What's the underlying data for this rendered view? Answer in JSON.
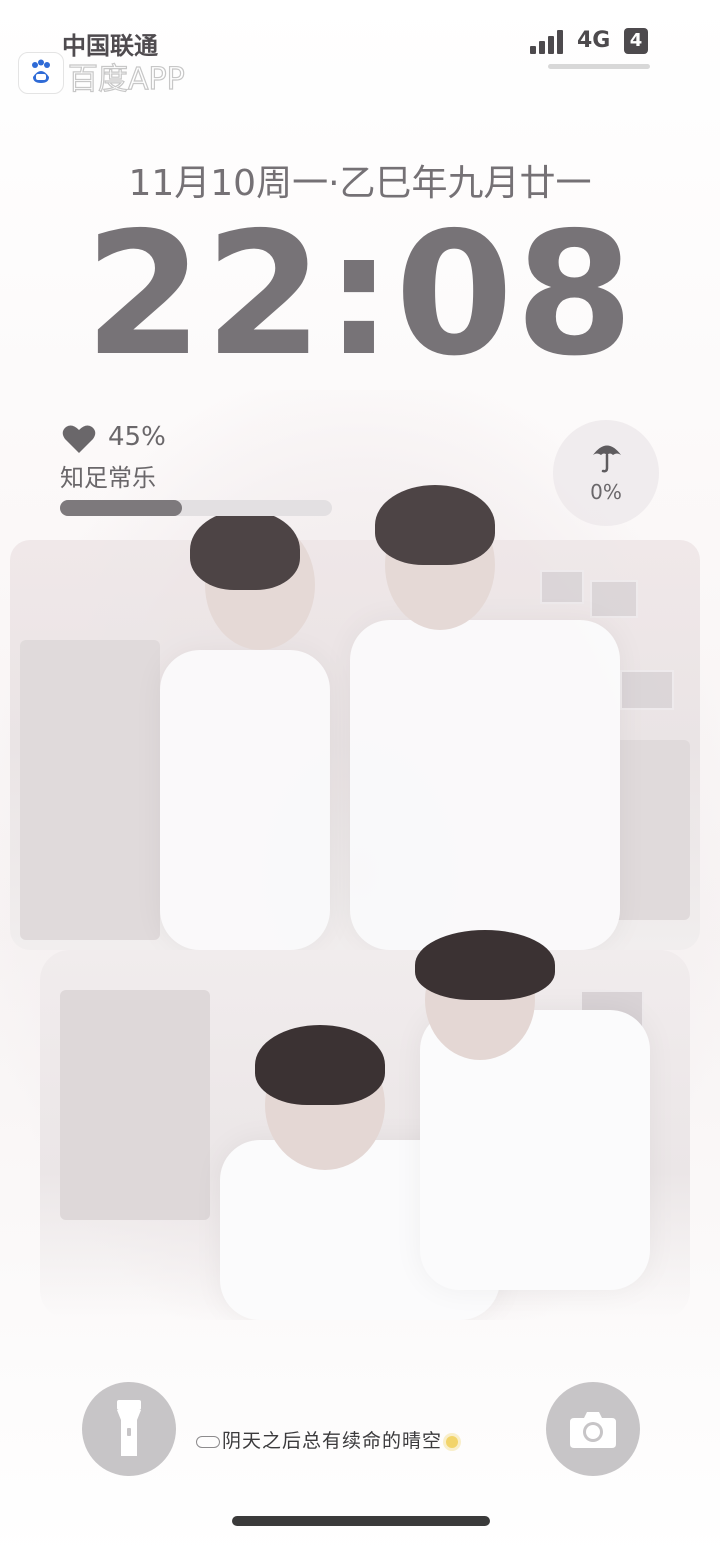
{
  "status_bar": {
    "carrier": "中国联通",
    "app_name": "百度APP",
    "network": "4G",
    "battery": "4"
  },
  "lockscreen": {
    "date": "11月10周一·乙巳年九月廿一",
    "time": "22:08"
  },
  "mood_widget": {
    "icon": "heart-icon",
    "percent_text": "45%",
    "percent_value": 0.45,
    "label": "知足常乐"
  },
  "rain_widget": {
    "icon": "umbrella-icon",
    "percent_text": "0%"
  },
  "bottom": {
    "flashlight_icon": "flashlight-icon",
    "camera_icon": "camera-icon",
    "quote": "阴天之后总有续命的晴空"
  },
  "colors": {
    "text_primary": "#777377",
    "button_bg": "#c7c5c7",
    "bar_fill": "#7d797c"
  }
}
